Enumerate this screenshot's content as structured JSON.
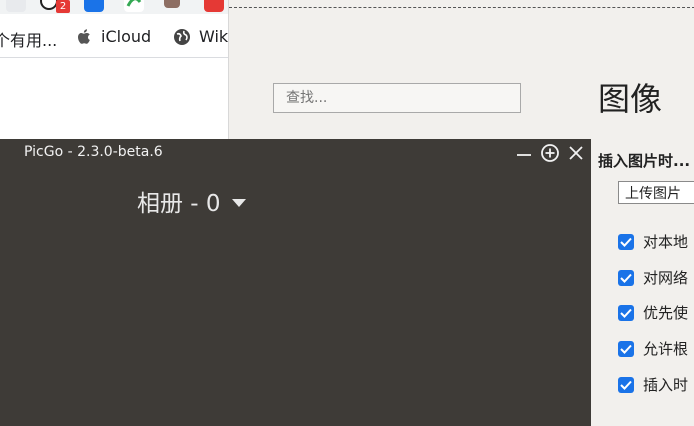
{
  "browser": {
    "tab_badge": "2",
    "bookmarks": [
      {
        "label": "个有用...",
        "icon": "truncated-bookmark"
      },
      {
        "label": "iCloud",
        "icon": "apple-icon"
      },
      {
        "label": "Wik",
        "icon": "wikipedia-icon"
      }
    ]
  },
  "settings": {
    "search_placeholder": "查找...",
    "page_title": "图像",
    "section_label": "插入图片时...",
    "select_value": "上传图片",
    "checkboxes": [
      {
        "label": "对本地",
        "checked": true
      },
      {
        "label": "对网络",
        "checked": true
      },
      {
        "label": "优先使",
        "checked": true
      },
      {
        "label": "允许根",
        "checked": true
      },
      {
        "label": "插入时",
        "checked": true
      }
    ]
  },
  "picgo": {
    "title": "PicGo - 2.3.0-beta.6",
    "album_label": "相册 - 0"
  },
  "colors": {
    "picgo_bg": "#3e3b37",
    "checkbox_accent": "#1a73e8",
    "badge": "#e53935"
  }
}
